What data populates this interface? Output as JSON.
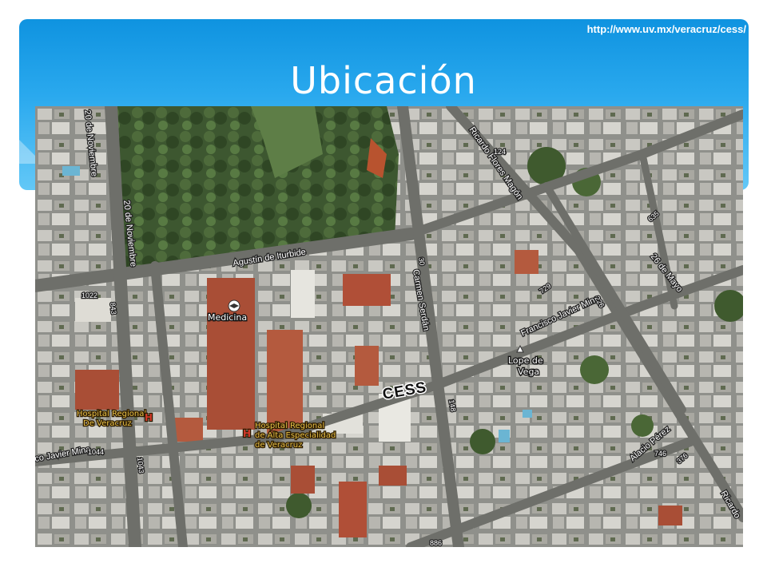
{
  "slide": {
    "title": "Ubicación",
    "url": "http://www.uv.mx/veracruz/cess/"
  },
  "map": {
    "marker_label": "CESS",
    "streets": {
      "noviembre_a": "20 de Noviembre",
      "noviembre_b": "20 de Noviembre",
      "iturbide": "Agustín de Iturbide",
      "flores_magon": "Ricardo Flores Magón",
      "serdan": "Carmen Serdán",
      "mina_right": "Francisco Javier Mina",
      "mina_left": "co Javier Mina",
      "mayo": "26 de Mayo",
      "alacio": "Alacio Pérez",
      "ricardo_edge": "Ricardo"
    },
    "places": {
      "medicina": "Medicina",
      "lope_a": "Lope de",
      "lope_b": "Vega",
      "hosp1_a": "Hospital Regional",
      "hosp1_b": "De Veracruz",
      "hosp2_a": "Hospital Regional",
      "hosp2_b": "de Alta Especialidad",
      "hosp2_c": "de Veracruz",
      "hospital_icon_text": "H"
    },
    "numbers": {
      "n1022": "1022",
      "n843": "843",
      "n1044": "1044",
      "n1043": "1043",
      "n124": "124",
      "n635": "635",
      "n729": "729",
      "n226": "226",
      "n30": "30",
      "n148": "148",
      "n746": "746",
      "n376": "376",
      "n886": "886"
    }
  },
  "colors": {
    "banner_top": "#0f93e0",
    "banner_bottom": "#63c8f7",
    "hospital_label": "#e8c14a"
  }
}
